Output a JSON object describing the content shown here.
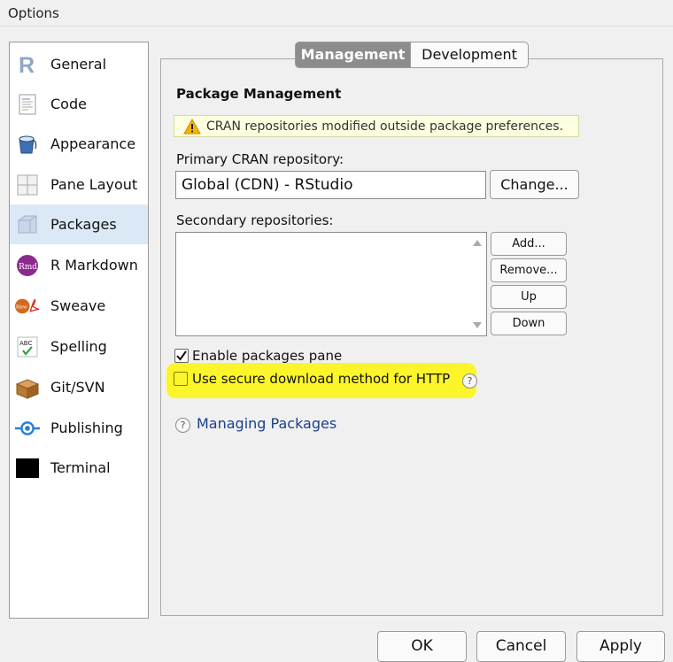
{
  "window": {
    "title": "Options"
  },
  "sidebar": {
    "items": [
      {
        "label": "General",
        "icon": "r-logo-icon"
      },
      {
        "label": "Code",
        "icon": "code-document-icon"
      },
      {
        "label": "Appearance",
        "icon": "paint-bucket-icon"
      },
      {
        "label": "Pane Layout",
        "icon": "pane-layout-icon"
      },
      {
        "label": "Packages",
        "icon": "package-box-icon",
        "selected": true
      },
      {
        "label": "R Markdown",
        "icon": "rmd-icon"
      },
      {
        "label": "Sweave",
        "icon": "sweave-pdf-icon"
      },
      {
        "label": "Spelling",
        "icon": "abc-check-icon"
      },
      {
        "label": "Git/SVN",
        "icon": "git-box-icon"
      },
      {
        "label": "Publishing",
        "icon": "publishing-icon"
      },
      {
        "label": "Terminal",
        "icon": "terminal-icon"
      }
    ]
  },
  "tabs": {
    "active": "Management",
    "inactive": "Development"
  },
  "main": {
    "heading": "Package Management",
    "warning": "CRAN repositories modified outside package preferences.",
    "primary_label": "Primary CRAN repository:",
    "primary_value": "Global (CDN) - RStudio",
    "change_button": "Change...",
    "secondary_label": "Secondary repositories:",
    "secondary_buttons": {
      "add": "Add...",
      "remove": "Remove...",
      "up": "Up",
      "down": "Down"
    },
    "enable_pane": {
      "label": "Enable packages pane",
      "checked": true
    },
    "secure_download": {
      "label": "Use secure download method for HTTP",
      "checked": false
    },
    "help_link": "Managing Packages"
  },
  "footer": {
    "ok": "OK",
    "cancel": "Cancel",
    "apply": "Apply"
  },
  "colors": {
    "selection": "#dbe8f6",
    "highlight": "#fbf52a",
    "link": "#1b3f8b",
    "active_tab": "#8c8c8c"
  }
}
